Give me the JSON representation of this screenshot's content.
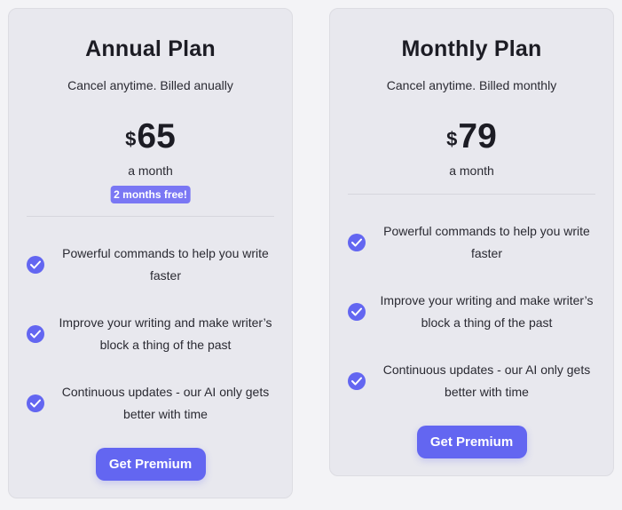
{
  "plans": [
    {
      "title": "Annual Plan",
      "subtitle": "Cancel anytime. Billed anually",
      "currency": "$",
      "price": "65",
      "period": "a month",
      "badge": "2 months free!",
      "features": [
        "Powerful commands to help you write faster",
        "Improve your writing and make writer’s block a thing of the past",
        "Continuous updates - our AI only gets better with time"
      ],
      "cta": "Get Premium"
    },
    {
      "title": "Monthly Plan",
      "subtitle": "Cancel anytime. Billed monthly",
      "currency": "$",
      "price": "79",
      "period": "a month",
      "features": [
        "Powerful commands to help you write faster",
        "Improve your writing and make writer’s block a thing of the past",
        "Continuous updates - our AI only gets better with time"
      ],
      "cta": "Get Premium"
    }
  ],
  "colors": {
    "accent": "#6366f1",
    "badge": "#7a77f4",
    "card_bg": "#e8e8ee"
  },
  "icons": {
    "feature": "check-circle-icon"
  }
}
